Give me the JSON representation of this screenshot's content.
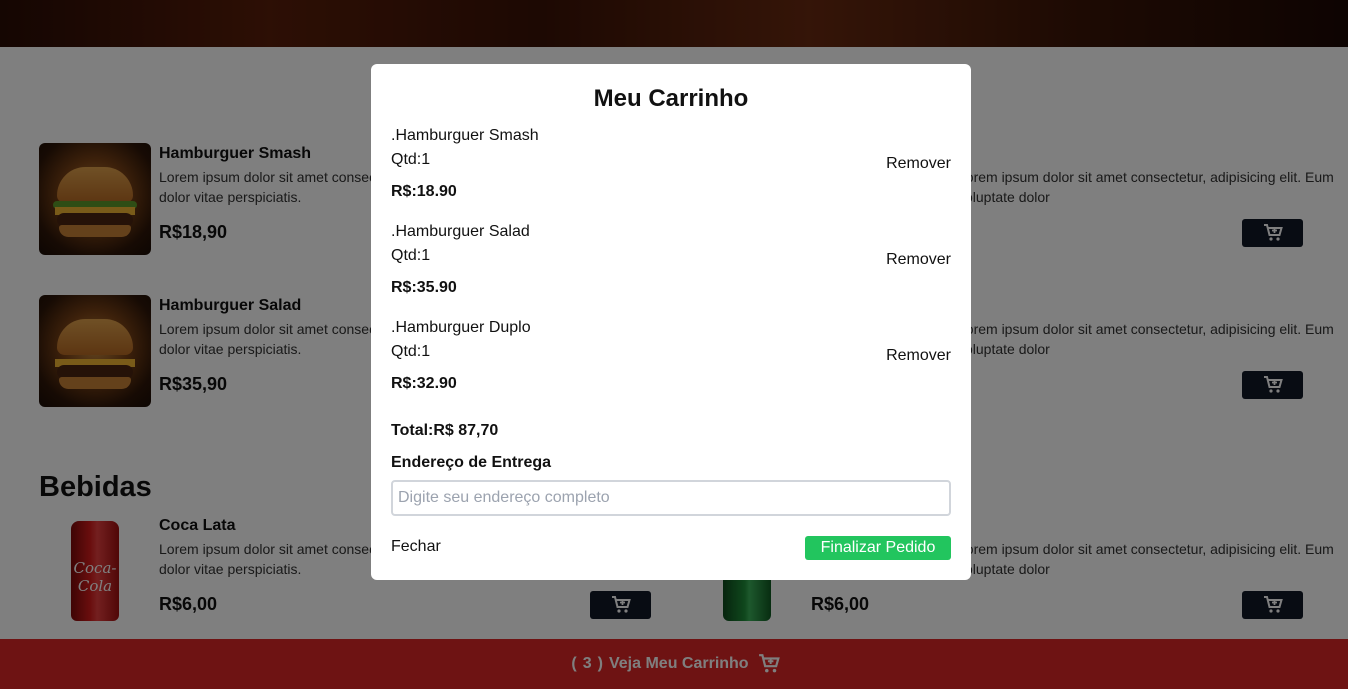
{
  "menu": {
    "items": [
      {
        "name": "Hamburguer Smash",
        "desc": "Lorem ipsum dolor sit amet consectetur, adipisicing elit. Eum voluptate dolor vitae perspiciatis.",
        "price": "R$18,90"
      },
      {
        "name": "Hamburguer Salad",
        "desc": "Lorem ipsum dolor sit amet consectetur, adipisicing elit. Eum voluptate dolor vitae perspiciatis.",
        "price": "R$35,90"
      }
    ],
    "right_items": [
      {
        "desc": "Lorem ipsum dolor sit amet consectetur, adipisicing elit. Eum voluptate dolor"
      },
      {
        "desc": "Lorem ipsum dolor sit amet consectetur, adipisicing elit. Eum voluptate dolor"
      }
    ],
    "drinks_title": "Bebidas",
    "drinks": [
      {
        "name": "Coca Lata",
        "desc": "Lorem ipsum dolor sit amet consectetur, adipisicing elit. Eum voluptate dolor vitae perspiciatis.",
        "price": "R$6,00",
        "can_text": "Coca-Cola"
      },
      {
        "desc": "Lorem ipsum dolor sit amet consectetur, adipisicing elit. Eum voluptate dolor",
        "price": "R$6,00"
      }
    ]
  },
  "footer": {
    "open_paren": "(",
    "count": "3",
    "close_paren": ")",
    "label": "Veja Meu Carrinho"
  },
  "modal": {
    "title": "Meu Carrinho",
    "items": [
      {
        "name": ".Hamburguer Smash",
        "qtd": "Qtd:1",
        "price": "R$:18.90",
        "remove": "Remover"
      },
      {
        "name": ".Hamburguer Salad",
        "qtd": "Qtd:1",
        "price": "R$:35.90",
        "remove": "Remover"
      },
      {
        "name": ".Hamburguer Duplo",
        "qtd": "Qtd:1",
        "price": "R$:32.90",
        "remove": "Remover"
      }
    ],
    "total": "Total:R$ 87,70",
    "address_label": "Endereço de Entrega",
    "address_placeholder": "Digite seu endereço completo",
    "address_value": "",
    "close_label": "Fechar",
    "finish_label": "Finalizar Pedido"
  },
  "colors": {
    "overlay": "rgba(0,0,0,0.5)",
    "footer": "#dc2626",
    "finish_button": "#22c55e",
    "add_button": "#111827"
  },
  "icons": {
    "cart": "cart-plus-icon"
  }
}
